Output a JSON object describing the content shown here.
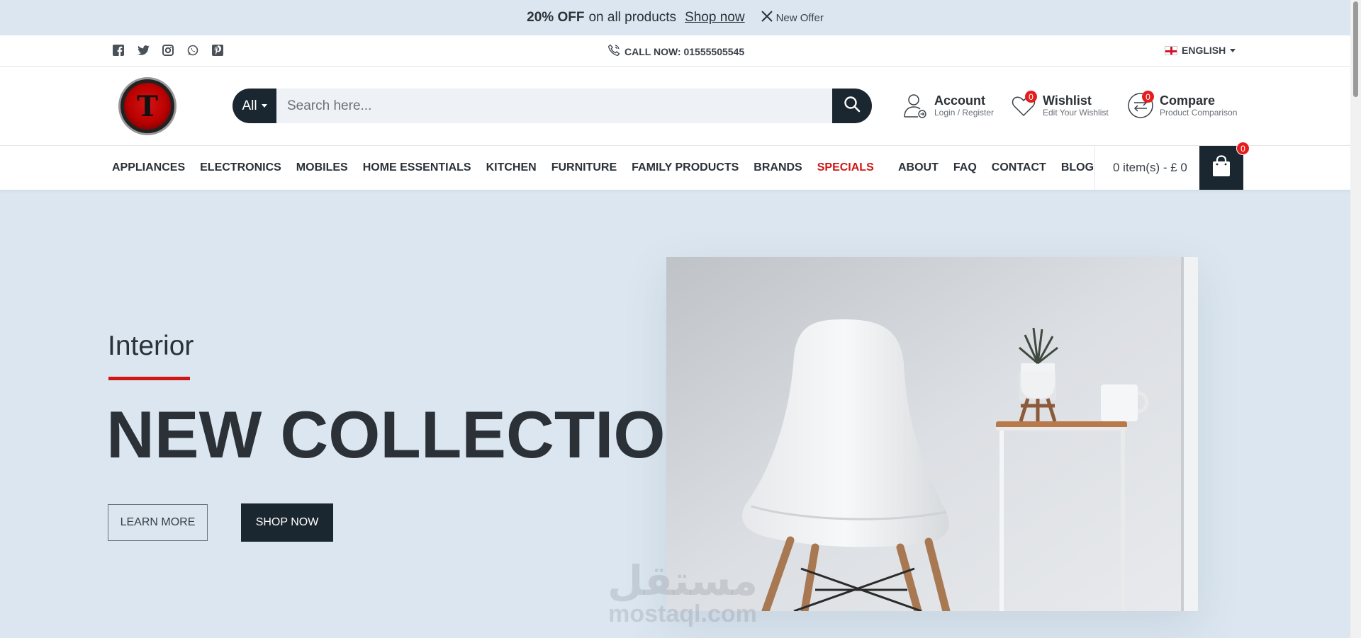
{
  "promo": {
    "discount": "20% OFF",
    "text": "on all products",
    "link": "Shop now",
    "offer_label": "New Offer"
  },
  "topbar": {
    "social": [
      "facebook-icon",
      "twitter-icon",
      "instagram-icon",
      "whatsapp-icon",
      "pinterest-icon"
    ],
    "call": "CALL NOW: 01555505545",
    "language": "ENGLISH"
  },
  "header": {
    "search": {
      "category": "All",
      "placeholder": "Search here..."
    },
    "account": {
      "title": "Account",
      "subtitle": "Login / Register"
    },
    "wishlist": {
      "title": "Wishlist",
      "subtitle": "Edit Your Wishlist",
      "count": "0"
    },
    "compare": {
      "title": "Compare",
      "subtitle": "Product Comparison",
      "count": "0"
    }
  },
  "nav": {
    "items": [
      "APPLIANCES",
      "ELECTRONICS",
      "MOBILES",
      "HOME ESSENTIALS",
      "KITCHEN",
      "FURNITURE",
      "FAMILY PRODUCTS",
      "BRANDS",
      "SPECIALS"
    ],
    "secondary": [
      "ABOUT",
      "FAQ",
      "CONTACT",
      "BLOG"
    ],
    "cart": {
      "summary": "0 item(s) - £ 0",
      "count": "0"
    }
  },
  "hero": {
    "subtitle": "Interior",
    "title": "NEW COLLECTION",
    "learn_more": "LEARN MORE",
    "shop_now": "SHOP NOW"
  },
  "watermark": {
    "arabic": "مستقل",
    "latin": "mostaql.com"
  },
  "colors": {
    "primary_dark": "#1b2730",
    "accent_red": "#d01515",
    "badge_red": "#e51d1d",
    "page_bg": "#dbe6f0"
  }
}
